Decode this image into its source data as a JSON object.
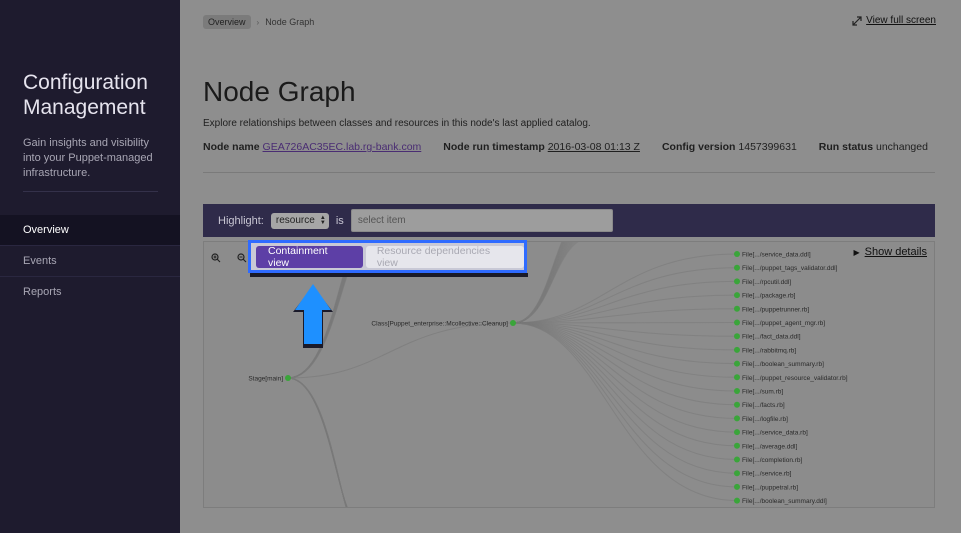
{
  "sidebar": {
    "title_line1": "Configuration",
    "title_line2": "Management",
    "description": "Gain insights and visibility into your Puppet-managed infrastructure.",
    "nav": [
      {
        "label": "Overview",
        "active": true
      },
      {
        "label": "Events",
        "active": false
      },
      {
        "label": "Reports",
        "active": false
      }
    ]
  },
  "breadcrumb": {
    "items": [
      "Overview",
      "Node Graph"
    ],
    "separator": "›"
  },
  "fullscreen_label": "View full screen",
  "page": {
    "title": "Node Graph",
    "description": "Explore relationships between classes and resources in this node's last applied catalog."
  },
  "meta": {
    "node_name_label": "Node name",
    "node_name": "GEA726AC35EC.lab.rg-bank.com",
    "timestamp_label": "Node run timestamp",
    "timestamp": "2016-03-08 01:13 Z",
    "config_label": "Config version",
    "config_version": "1457399631",
    "status_label": "Run status",
    "status": "unchanged"
  },
  "highlight": {
    "label": "Highlight:",
    "select_value": "resource",
    "is_label": "is",
    "input_placeholder": "select item"
  },
  "view_toggle": {
    "containment": "Containment view",
    "dependencies": "Resource dependencies view"
  },
  "show_details": "Show details",
  "graph": {
    "stage_label": "Stage[main]",
    "class_label": "Class[Puppet_enterprise::Mcollective::Cleanup]",
    "files": [
      "File[.../service_data.ddl]",
      "File[.../puppet_tags_validator.ddl]",
      "File[.../rpcutil.ddl]",
      "File[.../package.rb]",
      "File[.../puppetrunner.rb]",
      "File[.../puppet_agent_mgr.rb]",
      "File[.../fact_data.ddl]",
      "File[.../rabbitmq.rb]",
      "File[.../boolean_summary.rb]",
      "File[.../puppet_resource_validator.rb]",
      "File[.../sum.rb]",
      "File[.../facts.rb]",
      "File[.../logfile.rb]",
      "File[.../service_data.rb]",
      "File[.../average.ddl]",
      "File[.../completion.rb]",
      "File[.../service.rb]",
      "File[.../puppetral.rb]",
      "File[.../boolean_summary.ddl]"
    ],
    "node_color": "#3aa53a"
  },
  "colors": {
    "highlight_border": "#2f6bff",
    "containment_button": "#5d3fa6",
    "arrow": "#1e90ff"
  },
  "icons": {
    "zoom_in": "zoom-in-icon",
    "zoom_out": "zoom-out-icon",
    "expand": "expand-icon",
    "caret": "caret-right-icon"
  }
}
